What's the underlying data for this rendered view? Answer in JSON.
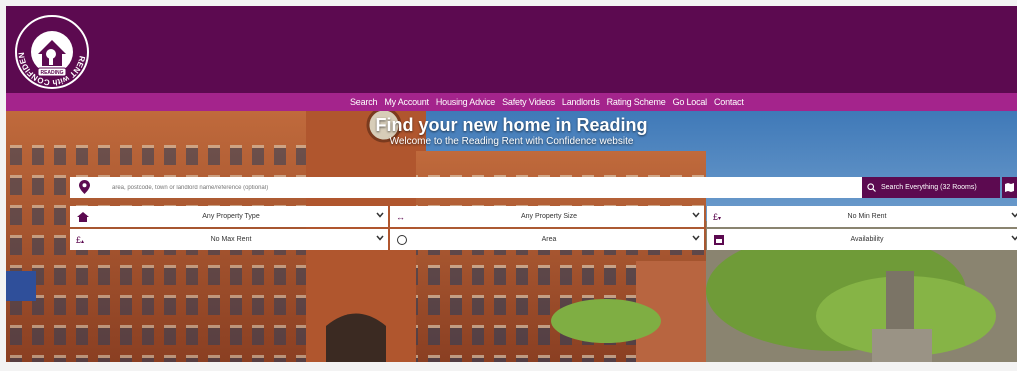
{
  "logo": {
    "ring_text": "RENT with CONFIDENCE",
    "badge_text": "READING"
  },
  "nav": {
    "items": [
      "Search",
      "My Account",
      "Housing Advice",
      "Safety Videos",
      "Landlords",
      "Rating Scheme",
      "Go Local",
      "Contact"
    ]
  },
  "hero": {
    "title": "Find your new home in Reading",
    "subtitle": "Welcome to the Reading Rent with Confidence website"
  },
  "search": {
    "placeholder": "area, postcode, town or landlord name/reference (optional)",
    "button_label": "Search Everything (32 Rooms)"
  },
  "filters": {
    "property_type": "Any Property Type",
    "property_size": "Any Property Size",
    "min_rent": "No Min Rent",
    "max_rent": "No Max Rent",
    "area": "Area",
    "availability": "Availability"
  },
  "icons": {
    "pound_up": "£",
    "pound_down": "£",
    "size": "↔"
  },
  "colors": {
    "header": "#5c0a50",
    "nav": "#a4248c"
  }
}
